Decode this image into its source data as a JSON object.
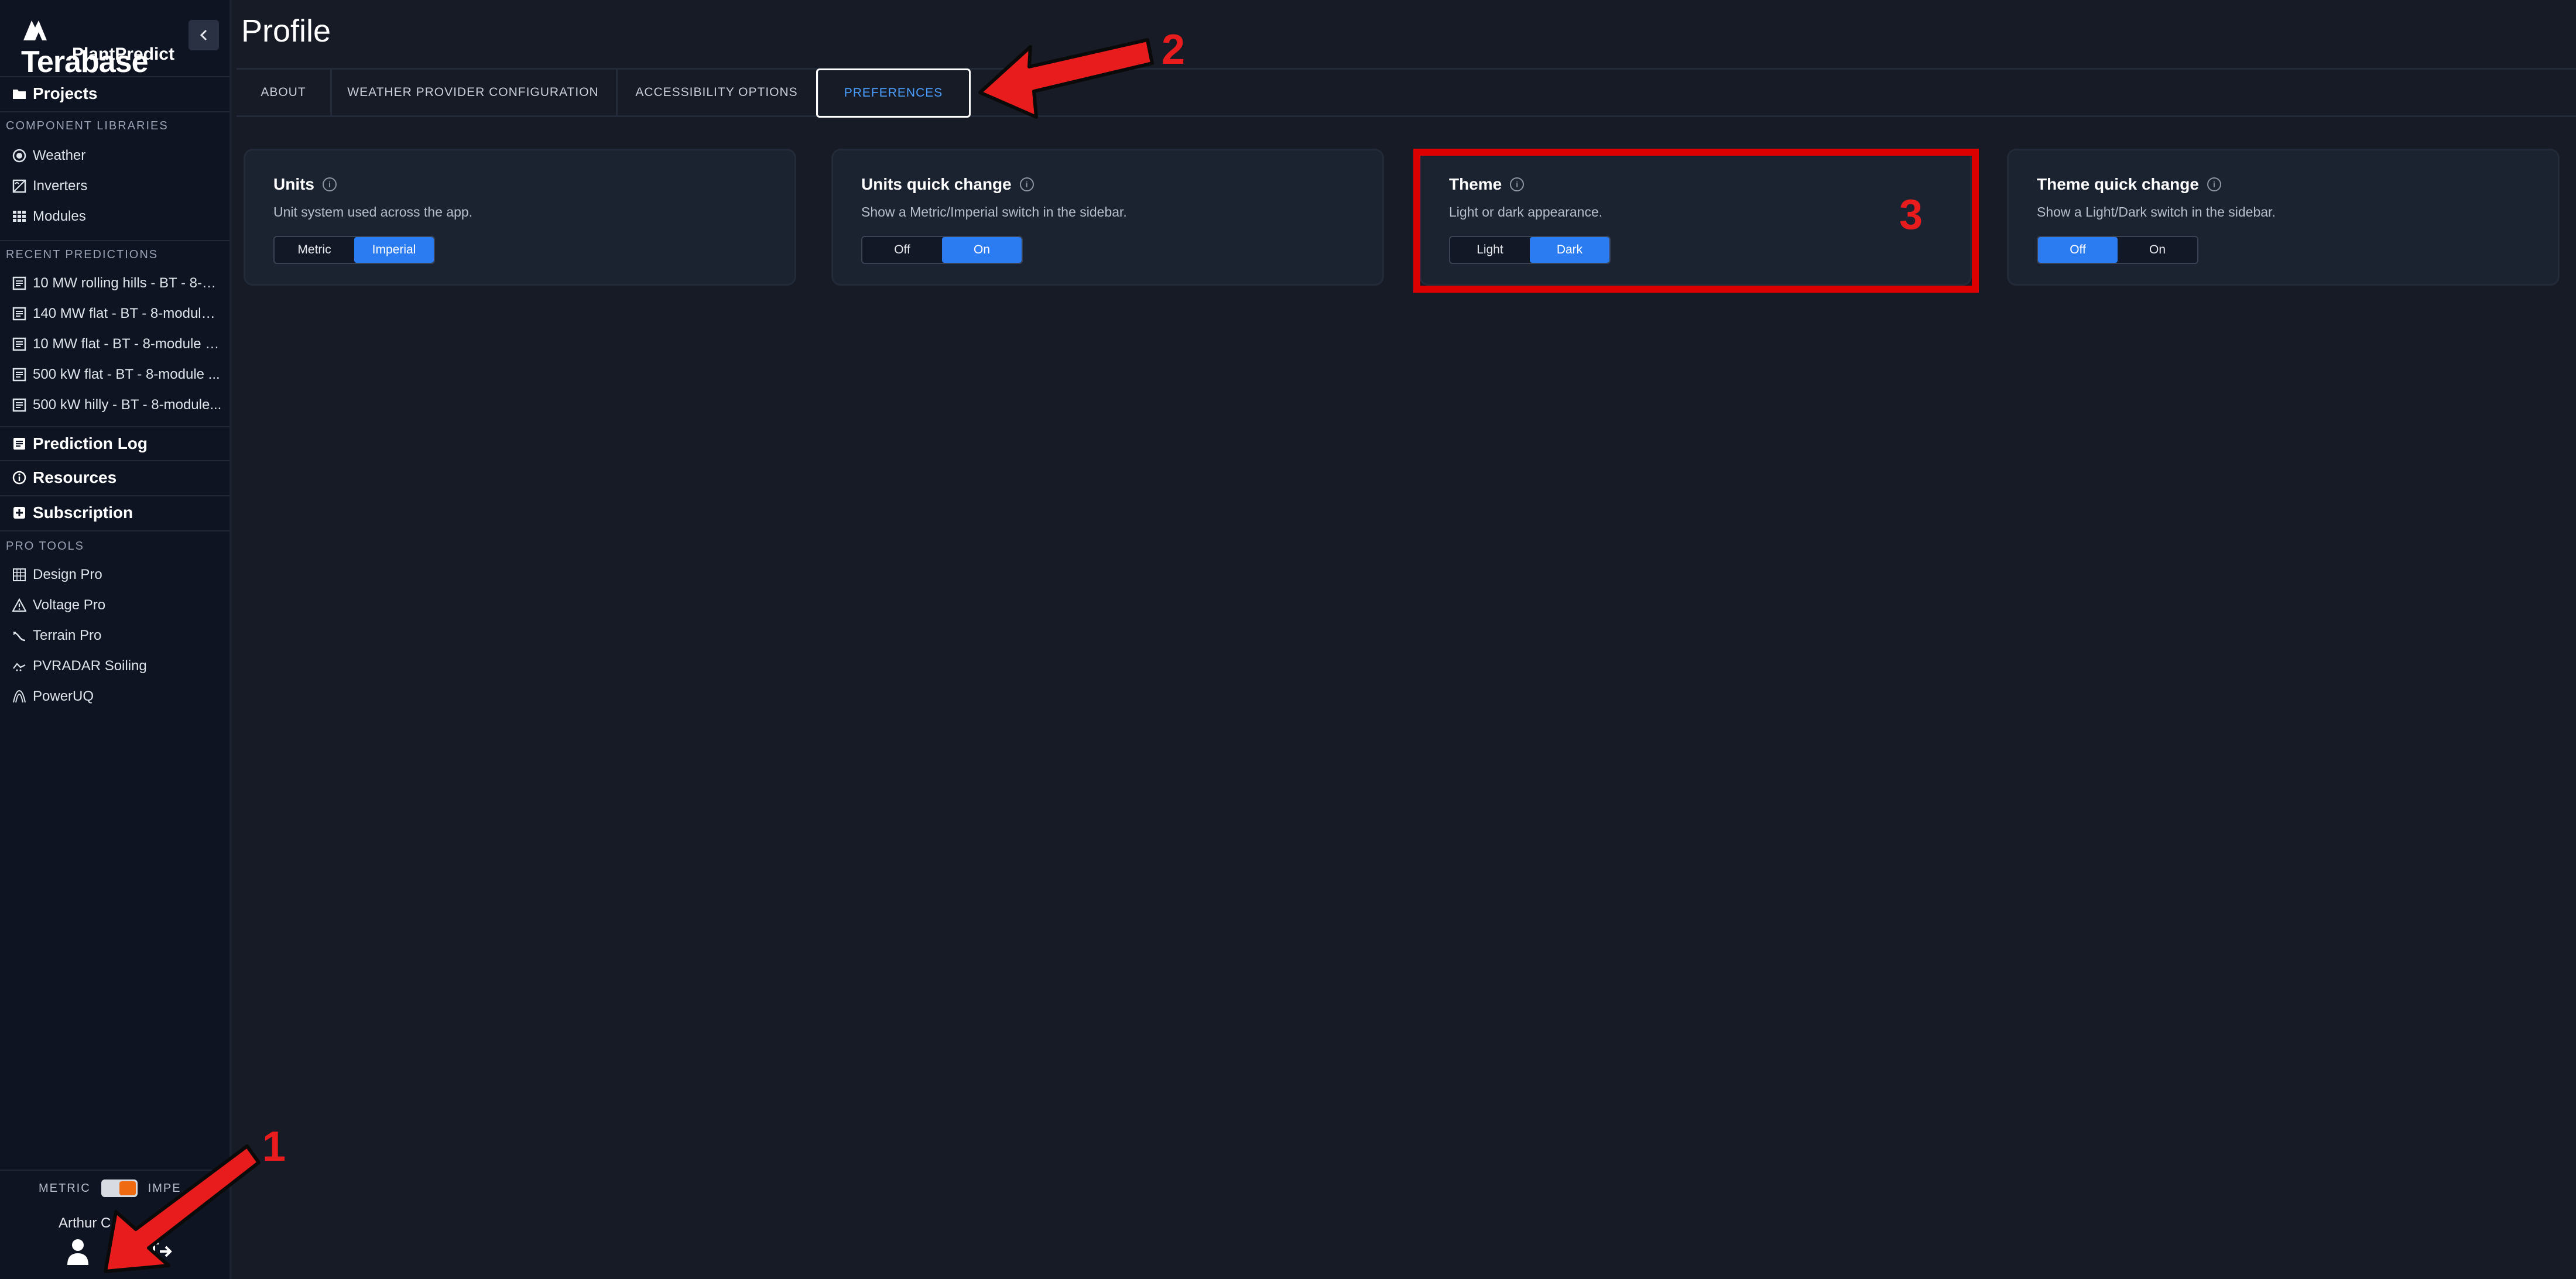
{
  "brand": {
    "wordmark": "Terabase",
    "product": "PlantPredict"
  },
  "page": {
    "title": "Profile"
  },
  "sidebar": {
    "projects_label": "Projects",
    "component_libraries_heading": "COMPONENT LIBRARIES",
    "component_libraries": [
      "Weather",
      "Inverters",
      "Modules"
    ],
    "recent_predictions_heading": "RECENT PREDICTIONS",
    "recent_predictions": [
      "10 MW rolling hills - BT - 8-m...",
      "140 MW flat - BT - 8-module ...",
      "10 MW flat - BT - 8-module b...",
      "500 kW flat - BT - 8-module ...",
      "500 kW hilly - BT - 8-module..."
    ],
    "prediction_log_label": "Prediction Log",
    "resources_label": "Resources",
    "subscription_label": "Subscription",
    "pro_tools_heading": "PRO TOOLS",
    "pro_tools": [
      "Design Pro",
      "Voltage Pro",
      "Terrain Pro",
      "PVRADAR Soiling",
      "PowerUQ"
    ],
    "unit_toggle": {
      "left_label": "METRIC",
      "right_label": "IMPE"
    },
    "user_name": "Arthur C"
  },
  "tabs": [
    "ABOUT",
    "WEATHER PROVIDER CONFIGURATION",
    "ACCESSIBILITY OPTIONS",
    "PREFERENCES"
  ],
  "active_tab": "PREFERENCES",
  "cards": [
    {
      "title": "Units",
      "description": "Unit system used across the app.",
      "options": [
        "Metric",
        "Imperial"
      ],
      "selected": "Imperial"
    },
    {
      "title": "Units quick change",
      "description": "Show a Metric/Imperial switch in the sidebar.",
      "options": [
        "Off",
        "On"
      ],
      "selected": "On"
    },
    {
      "title": "Theme",
      "description": "Light or dark appearance.",
      "options": [
        "Light",
        "Dark"
      ],
      "selected": "Dark"
    },
    {
      "title": "Theme quick change",
      "description": "Show a Light/Dark switch in the sidebar.",
      "options": [
        "Off",
        "On"
      ],
      "selected": "Off"
    }
  ],
  "annotations": {
    "n1": "1",
    "n2": "2",
    "n3": "3"
  },
  "colors": {
    "accent": "#2b7cf0",
    "annotation": "#e81c1c",
    "toggle_knob": "#f06a12"
  }
}
